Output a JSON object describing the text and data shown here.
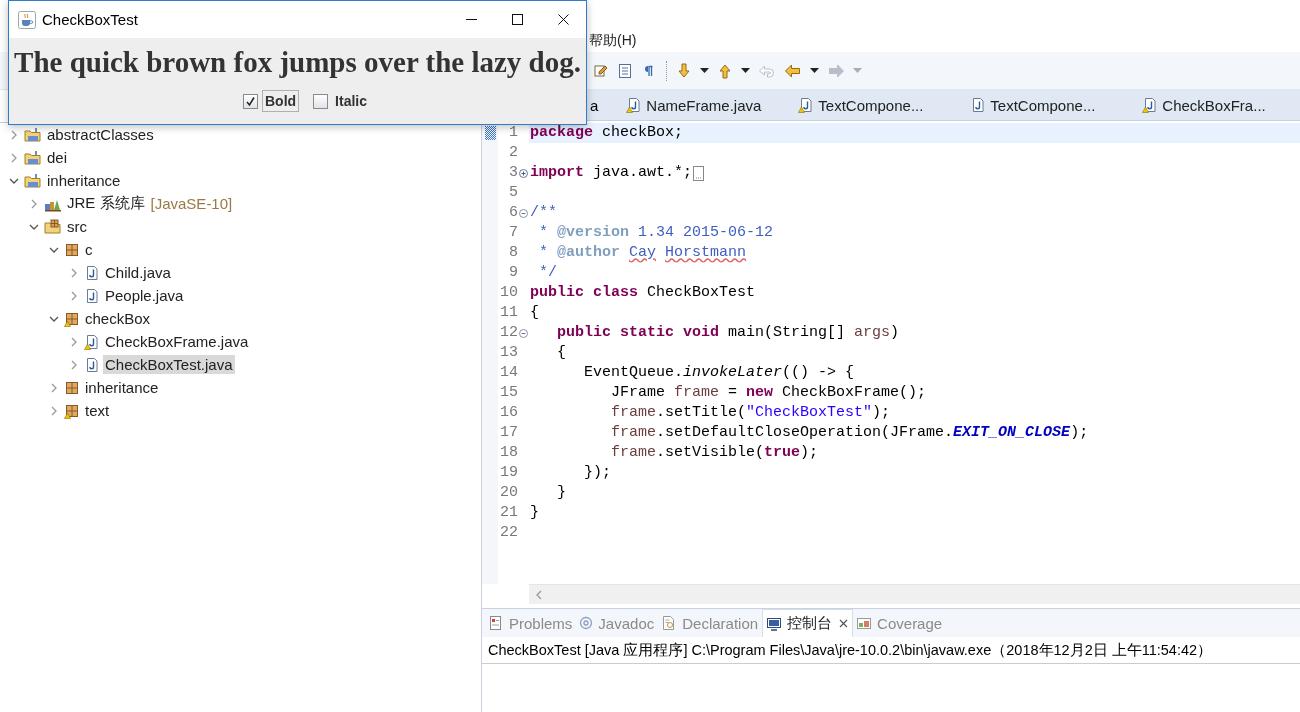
{
  "swing_window": {
    "title": "CheckBoxTest",
    "sample": "The quick brown fox jumps over the lazy dog.",
    "checkboxes": [
      {
        "label": "Bold",
        "checked": true,
        "focused": true,
        "kind": "bold"
      },
      {
        "label": "Italic",
        "checked": false,
        "focused": false,
        "kind": "italic"
      }
    ]
  },
  "ide": {
    "menu": [
      {
        "label": "帮助(H)"
      }
    ],
    "toolbar": [
      {
        "kind": "edit_mark",
        "disabled": false,
        "dropdown": false
      },
      {
        "kind": "block_selection",
        "disabled": false,
        "dropdown": false
      },
      {
        "kind": "whitespace",
        "disabled": false,
        "dropdown": false
      },
      {
        "kind": "separator"
      },
      {
        "kind": "next_annotation",
        "disabled": false,
        "dropdown": true
      },
      {
        "kind": "previous_annotation",
        "disabled": false,
        "dropdown": true
      },
      {
        "kind": "last_edit",
        "disabled": true,
        "dropdown": false
      },
      {
        "kind": "back",
        "disabled": false,
        "dropdown": true
      },
      {
        "kind": "forward",
        "disabled": true,
        "dropdown": true
      }
    ],
    "package_explorer": {
      "tree": [
        {
          "label": "abstractClasses",
          "kind": "project",
          "expanded": false,
          "selected": false,
          "warning": false
        },
        {
          "label": "dei",
          "kind": "project",
          "expanded": false,
          "selected": false,
          "warning": false
        },
        {
          "label": "inheritance",
          "kind": "project",
          "expanded": true,
          "selected": false,
          "warning": false,
          "children": [
            {
              "label": "JRE 系统库",
              "decoration": "[JavaSE-10]",
              "kind": "library",
              "expanded": false,
              "selected": false,
              "warning": false
            },
            {
              "label": "src",
              "kind": "source_folder",
              "expanded": true,
              "selected": false,
              "warning": false,
              "children": [
                {
                  "label": "c",
                  "kind": "package",
                  "expanded": true,
                  "selected": false,
                  "warning": false,
                  "children": [
                    {
                      "label": "Child.java",
                      "kind": "java_file",
                      "expanded": false,
                      "selected": false,
                      "warning": false
                    },
                    {
                      "label": "People.java",
                      "kind": "java_file",
                      "expanded": false,
                      "selected": false,
                      "warning": false
                    }
                  ]
                },
                {
                  "label": "checkBox",
                  "kind": "package",
                  "expanded": true,
                  "selected": false,
                  "warning": true,
                  "children": [
                    {
                      "label": "CheckBoxFrame.java",
                      "kind": "java_file",
                      "expanded": false,
                      "selected": false,
                      "warning": true
                    },
                    {
                      "label": "CheckBoxTest.java",
                      "kind": "java_file",
                      "expanded": false,
                      "selected": true,
                      "warning": false
                    }
                  ]
                },
                {
                  "label": "inheritance",
                  "kind": "package",
                  "expanded": false,
                  "selected": false,
                  "warning": false
                },
                {
                  "label": "text",
                  "kind": "package",
                  "expanded": false,
                  "selected": false,
                  "warning": true
                }
              ]
            }
          ]
        }
      ]
    },
    "editor": {
      "tabs": [
        {
          "label": "a",
          "kind": "label_only",
          "selected": false
        },
        {
          "label": "NameFrame.java",
          "kind": "java_file",
          "selected": false,
          "warning": true
        },
        {
          "label": "TextCompone...",
          "kind": "java_file",
          "selected": false,
          "warning": true
        },
        {
          "label": "TextCompone...",
          "kind": "java_file",
          "selected": false,
          "warning": false
        },
        {
          "label": "CheckBoxFra...",
          "kind": "java_file",
          "selected": false,
          "warning": true
        }
      ],
      "lines": [
        {
          "number": "1",
          "current": true,
          "changed": true,
          "fold_point": false,
          "tokens": [
            {
              "kind": "keyword",
              "text": "package"
            },
            {
              "kind": "plain",
              "text": " checkBox;"
            }
          ]
        },
        {
          "number": "2",
          "current": false,
          "changed": false,
          "fold_point": false
        },
        {
          "number": "3",
          "current": false,
          "changed": false,
          "fold_point": true,
          "collapsed": true,
          "tokens": [
            {
              "kind": "keyword",
              "text": "import"
            },
            {
              "kind": "plain",
              "text": " java.awt.*;"
            }
          ]
        },
        {
          "number": "5",
          "current": false,
          "changed": false,
          "fold_point": false
        },
        {
          "number": "6",
          "current": false,
          "changed": false,
          "fold_point": true,
          "collapsed": false,
          "tokens": [
            {
              "kind": "javadoc",
              "text": "/**"
            }
          ]
        },
        {
          "number": "7",
          "current": false,
          "changed": false,
          "fold_point": false,
          "tokens": [
            {
              "kind": "javadoc",
              "text": " * "
            },
            {
              "kind": "javadoc_tag",
              "text": "@version"
            },
            {
              "kind": "javadoc",
              "text": " 1.34 2015-06-12"
            }
          ]
        },
        {
          "number": "8",
          "current": false,
          "changed": false,
          "fold_point": false,
          "tokens": [
            {
              "kind": "javadoc",
              "text": " * "
            },
            {
              "kind": "javadoc_tag",
              "text": "@author"
            },
            {
              "kind": "misspelled",
              "text": " Cay"
            },
            {
              "kind": "misspelled",
              "text": " Horstmann"
            }
          ]
        },
        {
          "number": "9",
          "current": false,
          "changed": false,
          "fold_point": false,
          "tokens": [
            {
              "kind": "javadoc",
              "text": " */"
            }
          ]
        },
        {
          "number": "10",
          "current": false,
          "changed": false,
          "fold_point": false,
          "tokens": [
            {
              "kind": "keyword",
              "text": "public class"
            },
            {
              "kind": "plain",
              "text": " CheckBoxTest"
            }
          ]
        },
        {
          "number": "11",
          "current": false,
          "changed": false,
          "fold_point": false,
          "tokens": [
            {
              "kind": "plain",
              "text": "{"
            }
          ]
        },
        {
          "number": "12",
          "current": false,
          "changed": false,
          "fold_point": true,
          "collapsed": false,
          "tokens": [
            {
              "kind": "keyword",
              "text": "   public static void"
            },
            {
              "kind": "plain",
              "text": " main(String[] "
            },
            {
              "kind": "local",
              "text": "args"
            },
            {
              "kind": "plain",
              "text": ")"
            }
          ]
        },
        {
          "number": "13",
          "current": false,
          "changed": false,
          "fold_point": false,
          "tokens": [
            {
              "kind": "plain",
              "text": "   {"
            }
          ]
        },
        {
          "number": "14",
          "current": false,
          "changed": false,
          "fold_point": false,
          "tokens": [
            {
              "kind": "plain",
              "text": "      EventQueue."
            },
            {
              "kind": "static_method",
              "text": "invokeLater"
            },
            {
              "kind": "plain",
              "text": "(() -> {"
            }
          ]
        },
        {
          "number": "15",
          "current": false,
          "changed": false,
          "fold_point": false,
          "tokens": [
            {
              "kind": "plain",
              "text": "         JFrame "
            },
            {
              "kind": "local",
              "text": "frame"
            },
            {
              "kind": "plain",
              "text": " = "
            },
            {
              "kind": "keyword",
              "text": "new"
            },
            {
              "kind": "plain",
              "text": " CheckBoxFrame();"
            }
          ]
        },
        {
          "number": "16",
          "current": false,
          "changed": false,
          "fold_point": false,
          "tokens": [
            {
              "kind": "local",
              "text": "         frame"
            },
            {
              "kind": "plain",
              "text": ".setTitle("
            },
            {
              "kind": "string",
              "text": "\"CheckBoxTest\""
            },
            {
              "kind": "plain",
              "text": ");"
            }
          ]
        },
        {
          "number": "17",
          "current": false,
          "changed": false,
          "fold_point": false,
          "tokens": [
            {
              "kind": "local",
              "text": "         frame"
            },
            {
              "kind": "plain",
              "text": ".setDefaultCloseOperation(JFrame."
            },
            {
              "kind": "static_field",
              "text": "EXIT_ON_CLOSE"
            },
            {
              "kind": "plain",
              "text": ");"
            }
          ]
        },
        {
          "number": "18",
          "current": false,
          "changed": false,
          "fold_point": false,
          "tokens": [
            {
              "kind": "local",
              "text": "         frame"
            },
            {
              "kind": "plain",
              "text": ".setVisible("
            },
            {
              "kind": "keyword",
              "text": "true"
            },
            {
              "kind": "plain",
              "text": ");"
            }
          ]
        },
        {
          "number": "19",
          "current": false,
          "changed": false,
          "fold_point": false,
          "tokens": [
            {
              "kind": "plain",
              "text": "      });"
            }
          ]
        },
        {
          "number": "20",
          "current": false,
          "changed": false,
          "fold_point": false,
          "tokens": [
            {
              "kind": "plain",
              "text": "   }"
            }
          ]
        },
        {
          "number": "21",
          "current": false,
          "changed": false,
          "fold_point": false,
          "tokens": [
            {
              "kind": "plain",
              "text": "}"
            }
          ]
        },
        {
          "number": "22",
          "current": false,
          "changed": false,
          "fold_point": false
        }
      ]
    },
    "bottom_panel": {
      "tabs": [
        {
          "label": "Problems",
          "kind": "problems",
          "selected": false,
          "closable": false
        },
        {
          "label": "Javadoc",
          "kind": "javadoc",
          "selected": false,
          "closable": false
        },
        {
          "label": "Declaration",
          "kind": "declaration",
          "selected": false,
          "closable": false
        },
        {
          "label": "控制台",
          "kind": "console",
          "selected": true,
          "closable": true
        },
        {
          "label": "Coverage",
          "kind": "coverage",
          "selected": false,
          "closable": false
        }
      ],
      "console_header": "CheckBoxTest [Java 应用程序] C:\\Program Files\\Java\\jre-10.0.2\\bin\\javaw.exe（2018年12月2日 上午11:54:42）"
    }
  }
}
